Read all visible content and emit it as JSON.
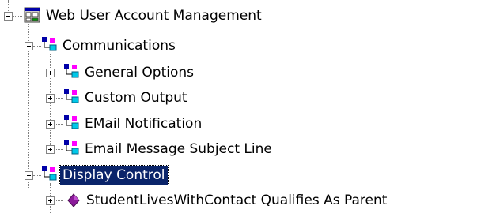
{
  "tree": {
    "root": {
      "label": "Web User Account Management",
      "icon": "console-icon",
      "expanded": true
    },
    "communications": {
      "label": "Communications",
      "icon": "folder-tree-icon",
      "expanded": true,
      "children": [
        {
          "label": "General Options",
          "icon": "folder-tree-icon",
          "expanded": false
        },
        {
          "label": "Custom Output",
          "icon": "folder-tree-icon",
          "expanded": false
        },
        {
          "label": "EMail Notification",
          "icon": "folder-tree-icon",
          "expanded": false
        },
        {
          "label": "Email Message Subject Line",
          "icon": "folder-tree-icon",
          "expanded": false
        }
      ]
    },
    "display_control": {
      "label": "Display Control",
      "icon": "folder-tree-icon",
      "expanded": true,
      "selected": true,
      "children": [
        {
          "label": "StudentLivesWithContact Qualifies As Parent",
          "icon": "diamond-icon",
          "expanded": false
        }
      ]
    }
  },
  "colors": {
    "selection_bg": "#0a246a",
    "icon_blue": "#0000a8",
    "icon_magenta": "#ff00ff",
    "icon_cyan": "#00c8e8",
    "diamond_purple": "#8b1a9a"
  }
}
